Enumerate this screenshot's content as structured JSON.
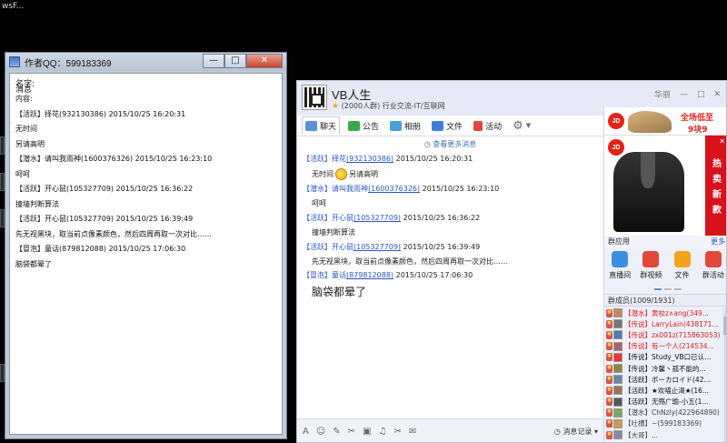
{
  "desktop": {
    "title_fragment": "wsF..."
  },
  "notepad": {
    "title": "作者QQ：599183369",
    "controls": {
      "minimize": "—",
      "maximize": "□",
      "close": "✕"
    },
    "header_overlap_a": "名字:",
    "header_overlap_b": "消息",
    "content_label": "内容:",
    "lines": [
      "【活跃】择花(932130386) 2015/10/25 16:20:31",
      "无时间",
      "另请高明",
      "【潜水】请叫我雨神(1600376326) 2015/10/25 16:23:10",
      "呵呵",
      "【活跃】开心鼠(105327709) 2015/10/25 16:36:22",
      "撞墙判断算法",
      "【活跃】开心鼠(105327709) 2015/10/25 16:39:49",
      "先无视黑块，取当前点像素颜色，然后四周再取一次对比……",
      "【冒泡】童话(879812088) 2015/10/25 17:06:30",
      "脑袋都晕了"
    ]
  },
  "qq": {
    "group_name": "VB人生",
    "group_size": "(2000人群)",
    "group_category": "行业交流-IT/互联网",
    "top_controls": {
      "style": "华丽",
      "min": "—",
      "max": "□",
      "close": "✕"
    },
    "tabs": [
      {
        "label": "聊天",
        "color": "#5b8fd6"
      },
      {
        "label": "公告",
        "color": "#3aa84a"
      },
      {
        "label": "相册",
        "color": "#4a9fd8"
      },
      {
        "label": "文件",
        "color": "#3d7fd6"
      },
      {
        "label": "活动",
        "color": "#e2473b"
      }
    ],
    "more_messages": "查看更多消息",
    "messages": [
      {
        "role": "【活跃】",
        "nick": "择花",
        "qq": "(932130386)",
        "time": " 2015/10/25 16:20:31",
        "text_a": "无时间",
        "text_b": "另请高明"
      },
      {
        "role": "【潜水】",
        "nick": "请叫我雨神",
        "qq": "(1600376326)",
        "time": " 2015/10/25 16:23:10",
        "text": "呵呵"
      },
      {
        "role": "【活跃】",
        "nick": "开心鼠",
        "qq": "(105327709)",
        "time": " 2015/10/25 16:36:22",
        "text": "撞墙判断算法"
      },
      {
        "role": "【活跃】",
        "nick": "开心鼠",
        "qq": "(105327709)",
        "time": " 2015/10/25 16:39:49",
        "text": "先无视黑块，取当前点像素颜色，然后四周再取一次对比……"
      },
      {
        "role": "【冒泡】",
        "nick": "童话",
        "qq": "(879812088)",
        "time": " 2015/10/25 17:06:30",
        "text": "脑袋都晕了"
      }
    ],
    "input_tools": [
      "A",
      "☺",
      "✎",
      "✂",
      "▣",
      "♫",
      "✂",
      "✉"
    ],
    "history_label": "消息记录",
    "ads": {
      "jd": "JD",
      "shoe_text_1": "全场低至",
      "shoe_text_2": "9块9",
      "hot_chars": [
        "热",
        "卖",
        "新",
        "款"
      ],
      "close": "✕"
    },
    "apps_header": "群应用",
    "apps_more": "更多",
    "apps": [
      {
        "label": "直播间",
        "color": "#3a8fe0"
      },
      {
        "label": "群视频",
        "color": "#e2473b"
      },
      {
        "label": "文件",
        "color": "#f0a51c"
      },
      {
        "label": "群活动",
        "color": "#e2473b"
      }
    ],
    "members_header": "群成员(1009/1931)",
    "members": [
      {
        "text": "【潜水】黄校z∧ang(349...",
        "style": "red",
        "avatar": "#c08a5a"
      },
      {
        "text": "【传说】LarryLain(438171...",
        "style": "red",
        "avatar": "#777"
      },
      {
        "text": "【传说】zx001z(715863053)",
        "style": "red",
        "avatar": "#4a7fb8"
      },
      {
        "text": "【传说】有一个人(214534...",
        "style": "red",
        "avatar": "#a66"
      },
      {
        "text": "【传说】Study_VB口已认...",
        "style": "blk",
        "avatar": "#e33"
      },
      {
        "text": "【传说】冷馨丶孤不能的...",
        "style": "blk",
        "avatar": "#884"
      },
      {
        "text": "【活跃】ボーカロイド(42...",
        "style": "blk",
        "avatar": "#68a"
      },
      {
        "text": "【活跃】★欢喵止渴★(16...",
        "style": "blk",
        "avatar": "#975"
      },
      {
        "text": "【活跃】无殇广瑜-小五(1...",
        "style": "blk",
        "avatar": "#555"
      },
      {
        "text": "【潜水】ChNzly(422964890)",
        "style": "gry",
        "avatar": "#7a6"
      },
      {
        "text": "【吐槽】~(599183369)",
        "style": "gry",
        "avatar": "#c95"
      },
      {
        "text": "【大哥】...",
        "style": "gry",
        "avatar": "#88a"
      }
    ]
  }
}
